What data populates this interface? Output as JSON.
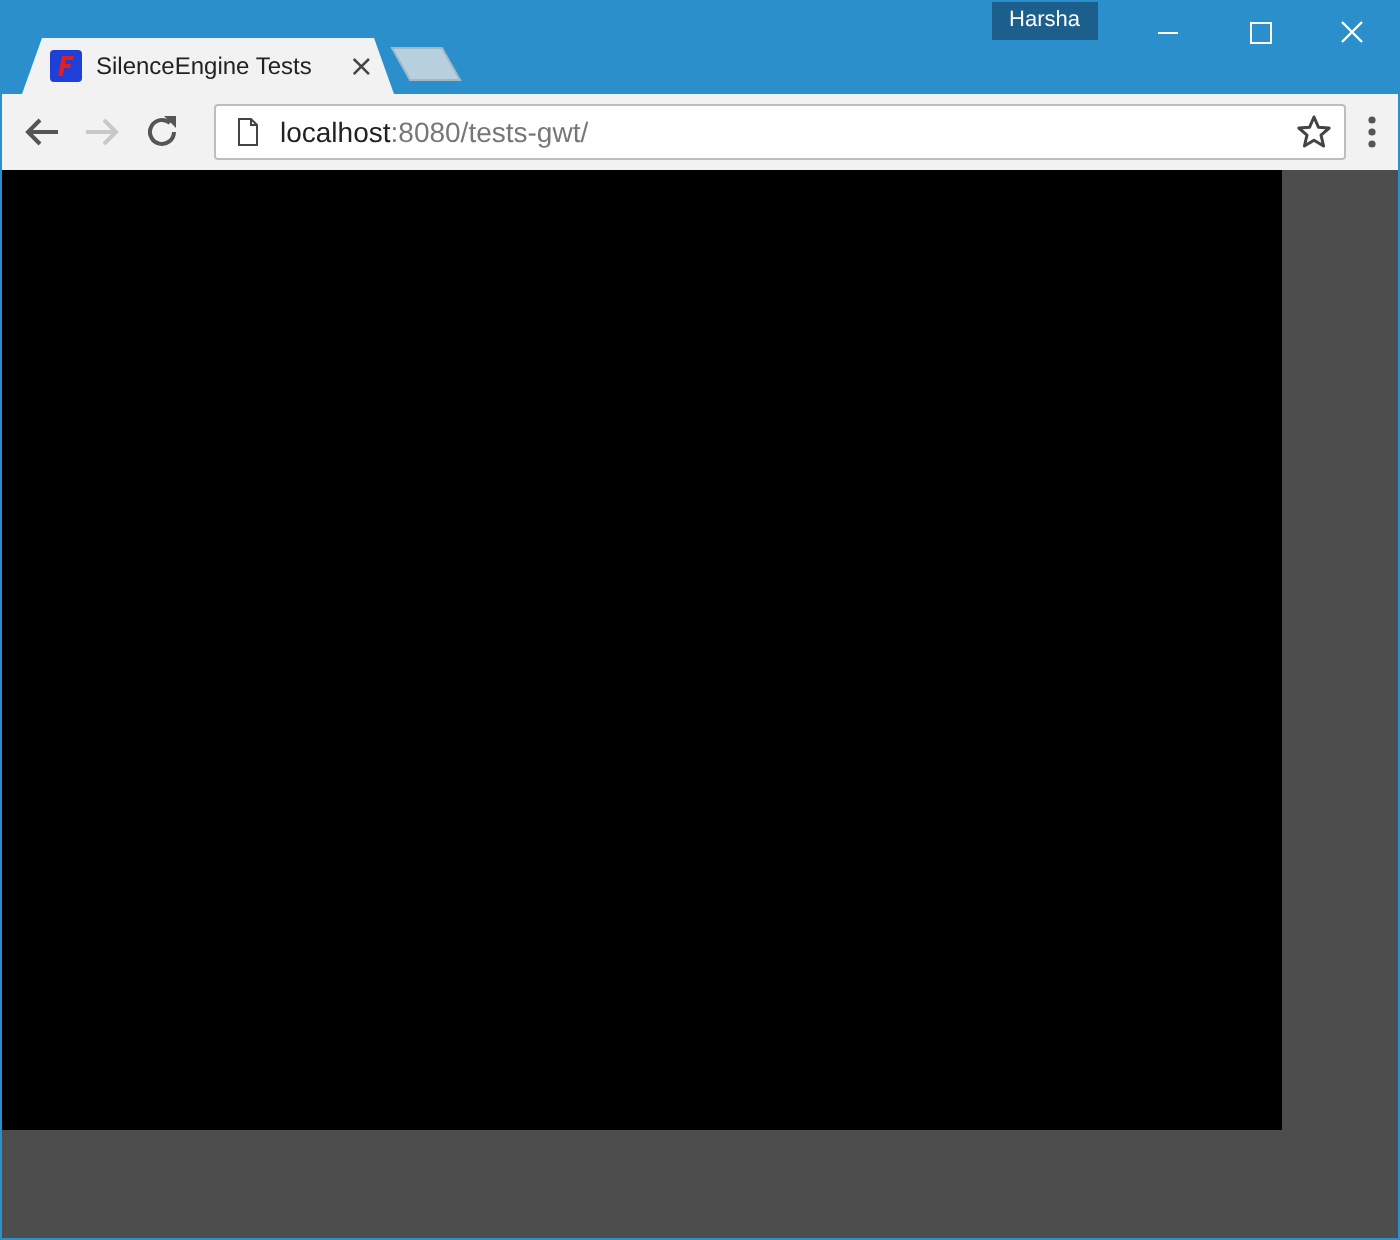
{
  "window": {
    "profile": "Harsha"
  },
  "tabs": [
    {
      "title": "SilenceEngine Tests",
      "selected": true,
      "close": "×"
    }
  ],
  "toolbar": {
    "forward_disabled": true
  },
  "address": {
    "host": "localhost",
    "path": ":8080/tests-gwt/"
  },
  "page": {
    "kind": "canvas"
  }
}
